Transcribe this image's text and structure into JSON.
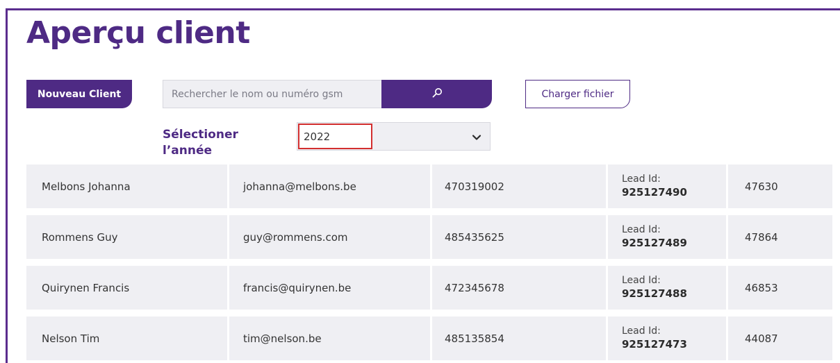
{
  "page": {
    "title": "Aperçu client"
  },
  "toolbar": {
    "new_client_label": "Nouveau Client",
    "search_placeholder": "Rechercher le nom ou numéro gsm",
    "search_value": "",
    "search_icon": "search-icon",
    "upload_label": "Charger fichier"
  },
  "year": {
    "label": "Sélectioner l’année",
    "selected": "2022",
    "dropdown_icon": "chevron-down-icon"
  },
  "colors": {
    "brand": "#4e2a84",
    "row_bg": "#efeff3",
    "highlight": "#d32f2f"
  },
  "clients": [
    {
      "name": "Melbons Johanna",
      "email": "johanna@melbons.be",
      "phone": "470319002",
      "lead_label": "Lead Id:",
      "lead_id": "925127490",
      "code": "47630"
    },
    {
      "name": "Rommens Guy",
      "email": "guy@rommens.com",
      "phone": "485435625",
      "lead_label": "Lead Id:",
      "lead_id": "925127489",
      "code": "47864"
    },
    {
      "name": "Quirynen Francis",
      "email": "francis@quirynen.be",
      "phone": "472345678",
      "lead_label": "Lead Id:",
      "lead_id": "925127488",
      "code": "46853"
    },
    {
      "name": "Nelson Tim",
      "email": "tim@nelson.be",
      "phone": "485135854",
      "lead_label": "Lead Id:",
      "lead_id": "925127473",
      "code": "44087"
    }
  ]
}
